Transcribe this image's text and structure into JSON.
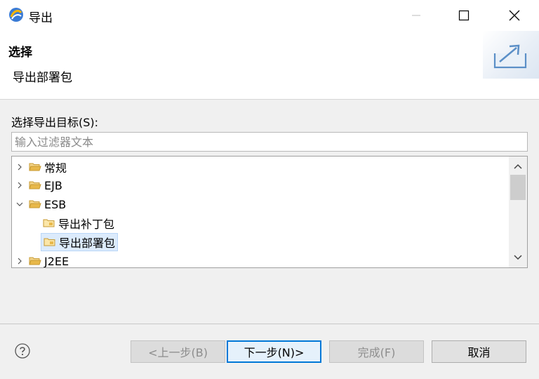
{
  "window": {
    "title": "导出"
  },
  "header": {
    "title": "选择",
    "description": "导出部署包"
  },
  "main": {
    "select_label": "选择导出目标(S):",
    "filter_placeholder": "输入过滤器文本",
    "tree": [
      {
        "label": "常规",
        "expanded": false,
        "level": 0,
        "selected": false
      },
      {
        "label": "EJB",
        "expanded": false,
        "level": 0,
        "selected": false
      },
      {
        "label": "ESB",
        "expanded": true,
        "level": 0,
        "selected": false
      },
      {
        "label": "导出补丁包",
        "level": 1,
        "selected": false
      },
      {
        "label": "导出部署包",
        "level": 1,
        "selected": true
      },
      {
        "label": "J2EE",
        "expanded": false,
        "level": 0,
        "selected": false
      }
    ]
  },
  "footer": {
    "back_label": "<上一步(B)",
    "next_label": "下一步(N)>",
    "finish_label": "完成(F)",
    "cancel_label": "取消"
  },
  "colors": {
    "selection": "#dcebfc",
    "default_button_border": "#0078d7",
    "folder": "#e8b84a"
  }
}
